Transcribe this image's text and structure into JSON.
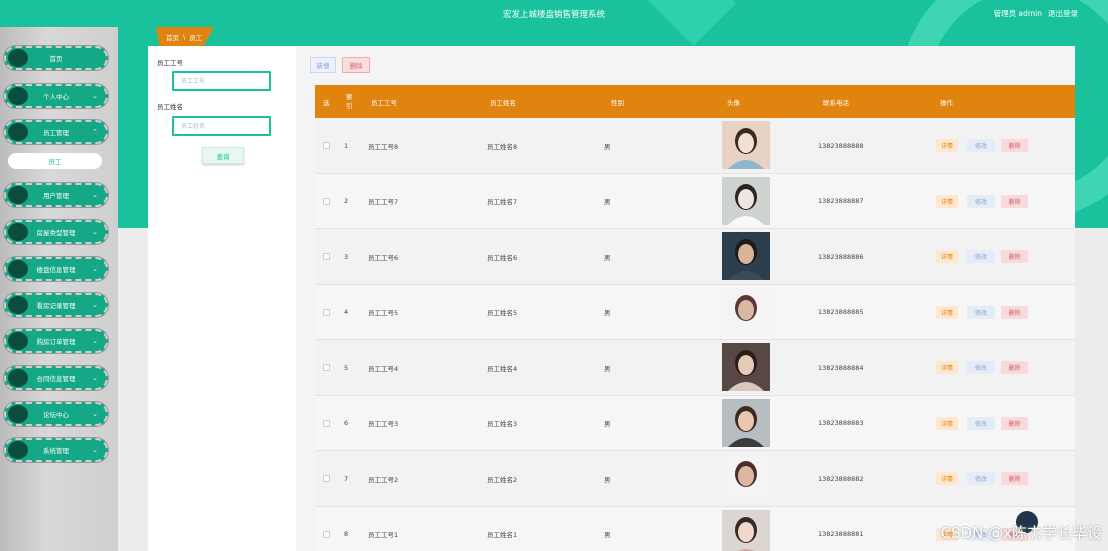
{
  "header": {
    "title": "宏发上城楼盘销售管理系统",
    "user_label": "管理员 admin",
    "logout_label": "退出登录"
  },
  "sidebar": {
    "items": [
      {
        "label": "首页",
        "has_chevron": false
      },
      {
        "label": "个人中心",
        "has_chevron": true
      },
      {
        "label": "员工管理",
        "has_chevron": true,
        "expanded": true
      },
      {
        "label": "用户管理",
        "has_chevron": true
      },
      {
        "label": "房屋类型管理",
        "has_chevron": true
      },
      {
        "label": "楼盘信息管理",
        "has_chevron": true
      },
      {
        "label": "看房记录管理",
        "has_chevron": true
      },
      {
        "label": "购房订单管理",
        "has_chevron": true
      },
      {
        "label": "合同信息管理",
        "has_chevron": true
      },
      {
        "label": "论坛中心",
        "has_chevron": true
      },
      {
        "label": "系统管理",
        "has_chevron": true
      }
    ],
    "sub_item": "员工"
  },
  "breadcrumb": {
    "home": "首页",
    "separator": "\\",
    "current": "员工"
  },
  "search": {
    "field1_label": "员工工号",
    "field1_placeholder": "员工工号",
    "field2_label": "员工姓名",
    "field2_placeholder": "员工姓名",
    "query_label": "查询"
  },
  "toolbar": {
    "add_label": "新增",
    "delete_label": "删除"
  },
  "table": {
    "headers": {
      "select": "选",
      "index": "索引",
      "emp_no": "员工工号",
      "emp_name": "员工姓名",
      "gender": "性别",
      "avatar": "头像",
      "phone": "联系电话",
      "actions": "操作"
    },
    "actions": {
      "detail": "详情",
      "edit": "修改",
      "delete": "删除"
    },
    "rows": [
      {
        "index": "1",
        "emp_no": "员工工号8",
        "emp_name": "员工姓名8",
        "gender": "男",
        "phone": "13823888888",
        "avatar": "photo-f1"
      },
      {
        "index": "2",
        "emp_no": "员工工号7",
        "emp_name": "员工姓名7",
        "gender": "男",
        "phone": "13823888887",
        "avatar": "photo-f2"
      },
      {
        "index": "3",
        "emp_no": "员工工号6",
        "emp_name": "员工姓名6",
        "gender": "男",
        "phone": "13823888886",
        "avatar": "photo-m1"
      },
      {
        "index": "4",
        "emp_no": "员工工号5",
        "emp_name": "员工姓名5",
        "gender": "男",
        "phone": "13823888885",
        "avatar": "photo-strip"
      },
      {
        "index": "5",
        "emp_no": "员工工号4",
        "emp_name": "员工姓名4",
        "gender": "男",
        "phone": "13823888884",
        "avatar": "photo-f3"
      },
      {
        "index": "6",
        "emp_no": "员工工号3",
        "emp_name": "员工姓名3",
        "gender": "男",
        "phone": "13823888883",
        "avatar": "photo-m2"
      },
      {
        "index": "7",
        "emp_no": "员工工号2",
        "emp_name": "员工姓名2",
        "gender": "男",
        "phone": "13823888882",
        "avatar": "photo-strip2"
      },
      {
        "index": "8",
        "emp_no": "员工工号1",
        "emp_name": "员工姓名1",
        "gender": "男",
        "phone": "13823888881",
        "avatar": "photo-f4"
      }
    ]
  },
  "watermark": "CSDN @x陈杰学长毕设"
}
